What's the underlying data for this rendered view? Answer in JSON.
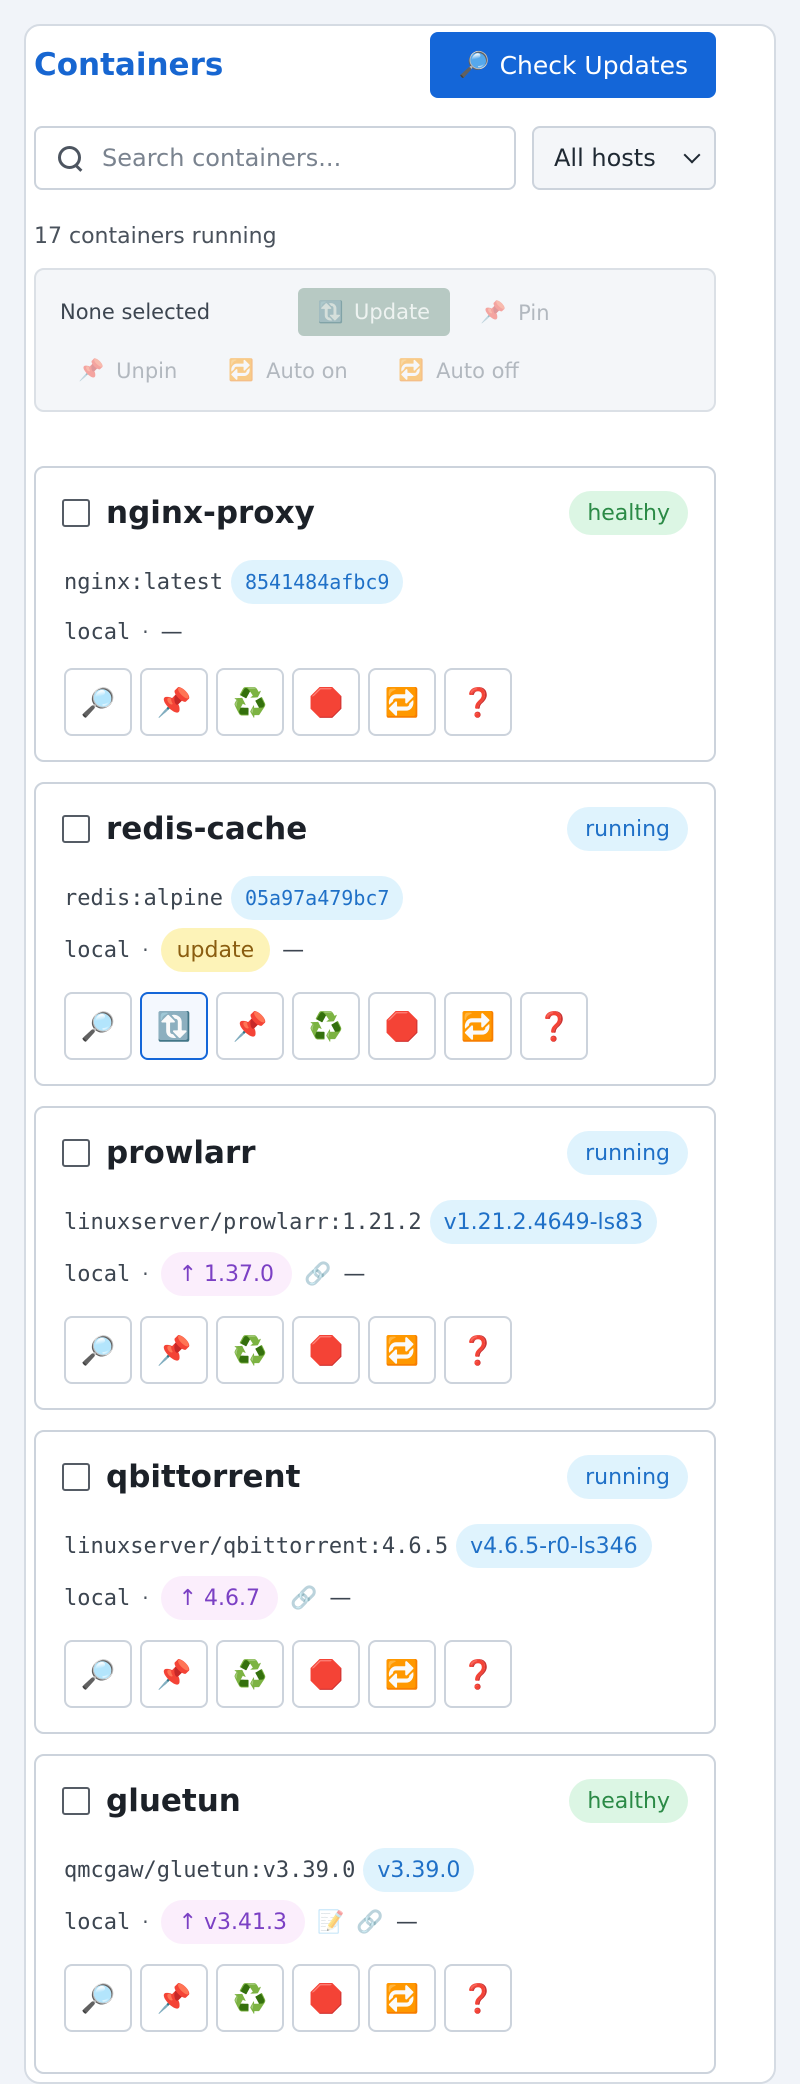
{
  "header": {
    "title": "Containers",
    "check_updates_label": "Check Updates",
    "check_updates_icon": "🔎"
  },
  "search": {
    "placeholder": "Search containers...",
    "host_filter": "All hosts"
  },
  "summary": {
    "count_text": "17 containers running"
  },
  "bulk": {
    "selection_text": "None selected",
    "update_label": "Update",
    "update_icon": "🔃",
    "pin_label": "Pin",
    "pin_icon": "📌",
    "unpin_label": "Unpin",
    "unpin_icon": "📌",
    "auto_on_label": "Auto on",
    "auto_on_icon": "🔁",
    "auto_off_label": "Auto off",
    "auto_off_icon": "🔁"
  },
  "containers": [
    {
      "name": "nginx-proxy",
      "status": "healthy",
      "image": "nginx:latest",
      "tag": "8541484afbc9",
      "host": "local",
      "sep": "·",
      "dash": "—",
      "actions": [
        "🔎",
        "📌",
        "♻️",
        "🛑",
        "🔁",
        "❓"
      ]
    },
    {
      "name": "redis-cache",
      "status": "running",
      "image": "redis:alpine",
      "tag": "05a97a479bc7",
      "host": "local",
      "sep": "·",
      "update_badge": "update",
      "dash": "—",
      "actions": [
        "🔎",
        "🔃",
        "📌",
        "♻️",
        "🛑",
        "🔁",
        "❓"
      ]
    },
    {
      "name": "prowlarr",
      "status": "running",
      "image": "linuxserver/prowlarr:1.21.2",
      "tag": "v1.21.2.4649-ls83",
      "host": "local",
      "sep": "·",
      "new_version": "↑ 1.37.0",
      "link_icon": "🔗",
      "dash": "—",
      "actions": [
        "🔎",
        "📌",
        "♻️",
        "🛑",
        "🔁",
        "❓"
      ]
    },
    {
      "name": "qbittorrent",
      "status": "running",
      "image": "linuxserver/qbittorrent:4.6.5",
      "tag": "v4.6.5-r0-ls346",
      "host": "local",
      "sep": "·",
      "new_version": "↑ 4.6.7",
      "link_icon": "🔗",
      "dash": "—",
      "actions": [
        "🔎",
        "📌",
        "♻️",
        "🛑",
        "🔁",
        "❓"
      ]
    },
    {
      "name": "gluetun",
      "status": "healthy",
      "image": "qmcgaw/gluetun:v3.39.0",
      "tag": "v3.39.0",
      "host": "local",
      "sep": "·",
      "new_version": "↑ v3.41.3",
      "note_icon": "📝",
      "link_icon": "🔗",
      "dash": "—",
      "actions": [
        "🔎",
        "📌",
        "♻️",
        "🛑",
        "🔁",
        "❓"
      ]
    }
  ],
  "colors": {
    "accent": "#1466d8",
    "title": "#1766d1",
    "healthy_bg": "#dcf6e4",
    "running_bg": "#dff3fd",
    "update_bg": "#fdf3b8",
    "newver_bg": "#fbeefc"
  }
}
